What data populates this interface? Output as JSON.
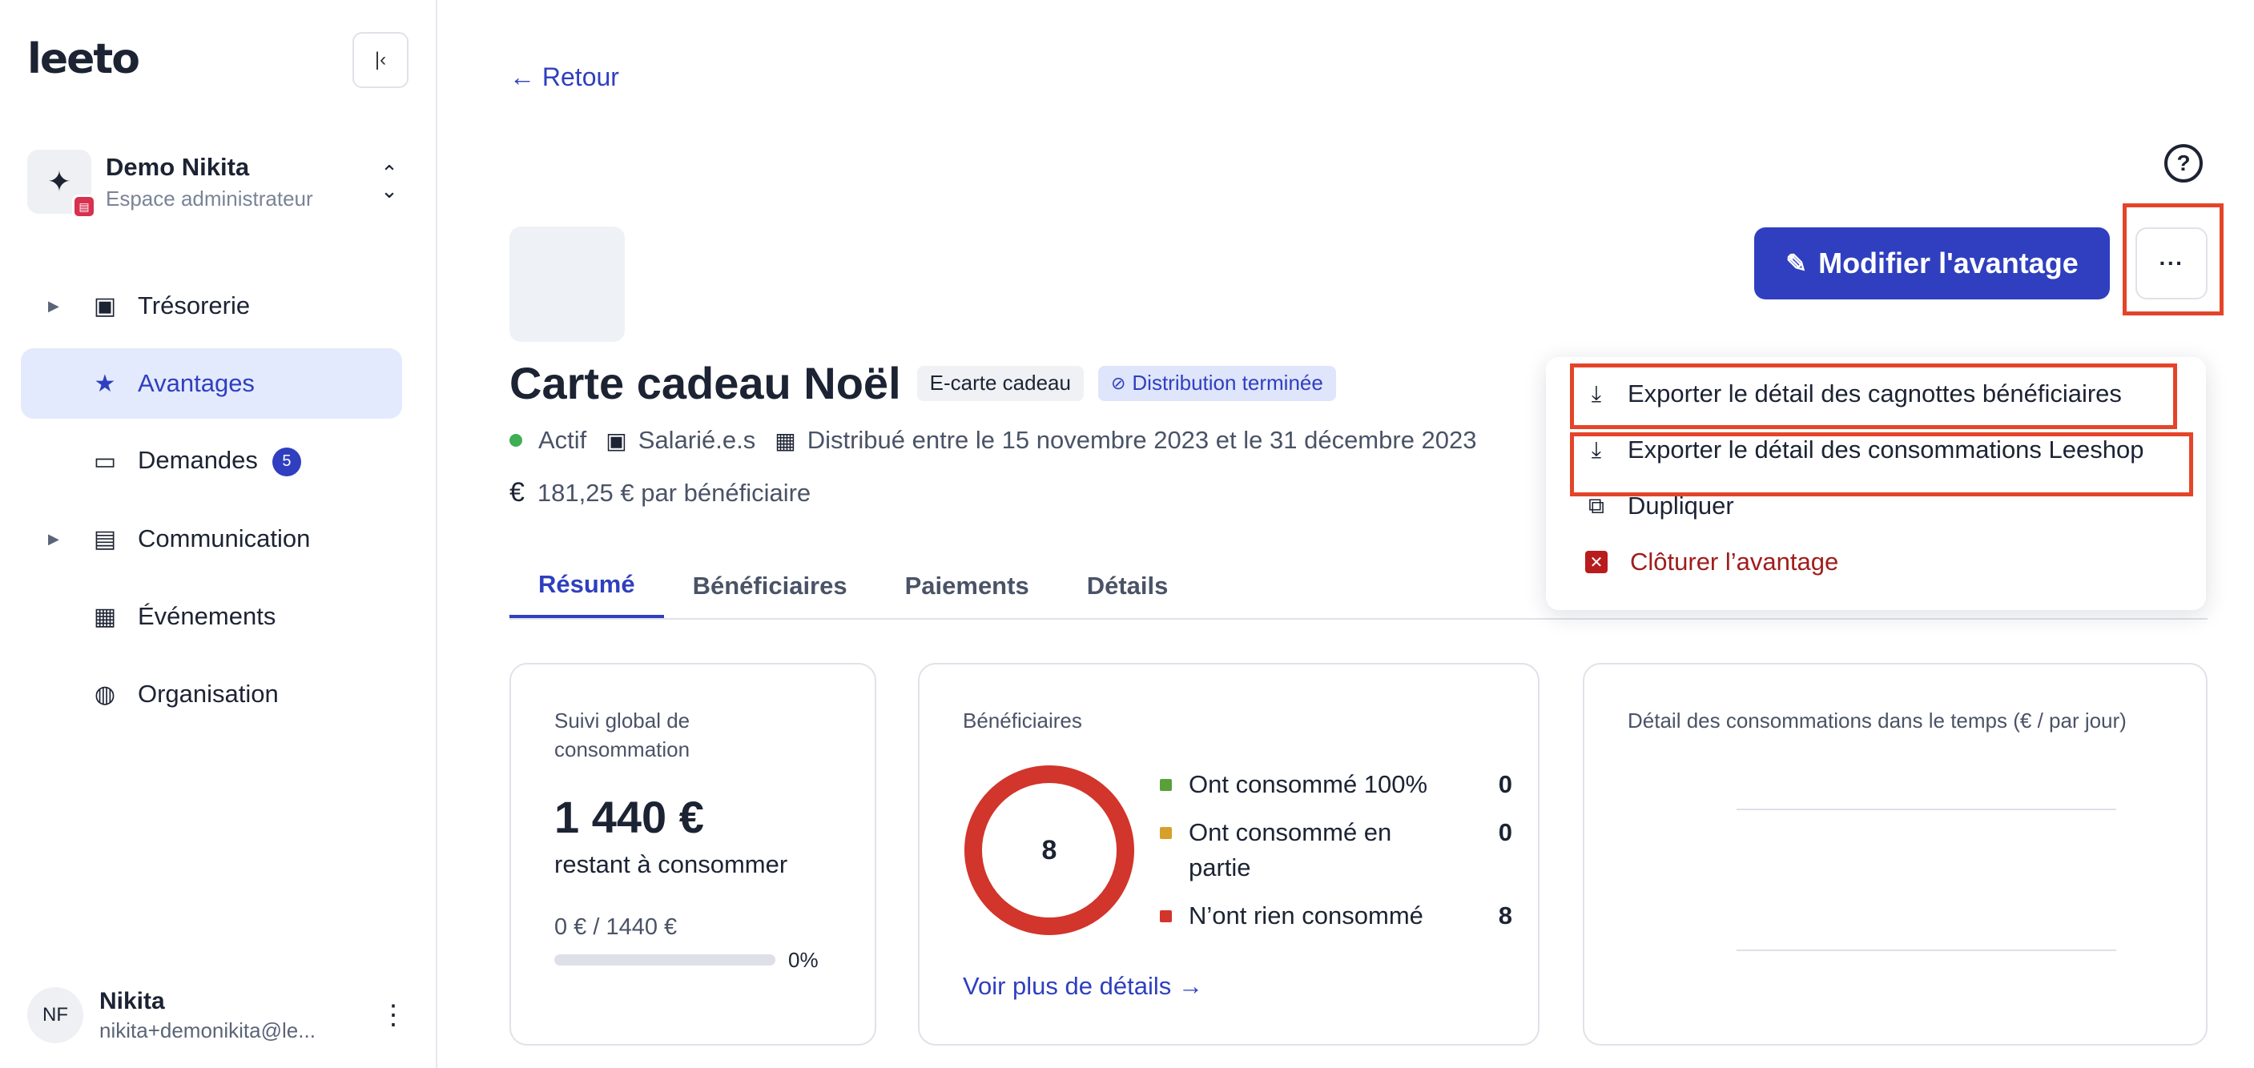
{
  "sidebar": {
    "logo": "leeto",
    "collapse_icon": "collapse-left-icon",
    "workspace": {
      "name": "Demo Nikita",
      "subtitle": "Espace administrateur",
      "icon": "sparkles-icon"
    },
    "items": [
      {
        "label": "Trésorerie",
        "icon": "wallet-icon",
        "expandable": true
      },
      {
        "label": "Avantages",
        "icon": "star-icon",
        "active": true
      },
      {
        "label": "Demandes",
        "icon": "inbox-icon",
        "count": "5"
      },
      {
        "label": "Communication",
        "icon": "newspaper-icon",
        "expandable": true
      },
      {
        "label": "Événements",
        "icon": "calendar-icon"
      },
      {
        "label": "Organisation",
        "icon": "organisation-icon"
      }
    ],
    "user": {
      "initials": "NF",
      "name": "Nikita",
      "email": "nikita+demonikita@le..."
    }
  },
  "header": {
    "back_label": "Retour",
    "help_icon": "help-circle-icon",
    "edit_label": "Modifier l'avantage",
    "more_label": "···"
  },
  "benefit": {
    "title": "Carte cadeau Noël",
    "type_tag": "E-carte cadeau",
    "status_tag": "Distribution terminée",
    "status": "Actif",
    "audience": "Salarié.e.s",
    "period": "Distribué entre le 15 novembre 2023 et le 31 décembre 2023",
    "price": "181,25 € par bénéficiaire",
    "currency_symbol": "€"
  },
  "tabs": [
    "Résumé",
    "Bénéficiaires",
    "Paiements",
    "Détails"
  ],
  "dropdown": {
    "items": [
      {
        "label": "Exporter le détail des cagnottes bénéficiaires",
        "icon": "download-icon"
      },
      {
        "label": "Exporter le détail des consommations Leeshop",
        "icon": "download-icon"
      },
      {
        "label": "Dupliquer",
        "icon": "copy-icon"
      },
      {
        "label": "Clôturer l’avantage",
        "icon": "close-box-icon"
      }
    ]
  },
  "cards": {
    "consumption": {
      "title": "Suivi global de consommation",
      "amount": "1 440 €",
      "subtitle": "restant à consommer",
      "ratio": "0 € / 1440 €",
      "percent_label": "0%",
      "progress": 0
    },
    "beneficiaries": {
      "title": "Bénéficiaires",
      "total": "8",
      "legend": [
        {
          "label": "Ont consommé 100%",
          "value": "0",
          "color": "#5aa03a"
        },
        {
          "label": "Ont consommé en partie",
          "value": "0",
          "color": "#d6a02a"
        },
        {
          "label": "N’ont rien consommé",
          "value": "8",
          "color": "#d2352b"
        }
      ],
      "link": "Voir plus de détails →"
    },
    "timeline": {
      "title": "Détail des consommations dans le temps (€ / par jour)"
    }
  },
  "colors": {
    "accent": "#2f3fbf",
    "highlight": "#e4442a",
    "donut": "#d2352b"
  }
}
